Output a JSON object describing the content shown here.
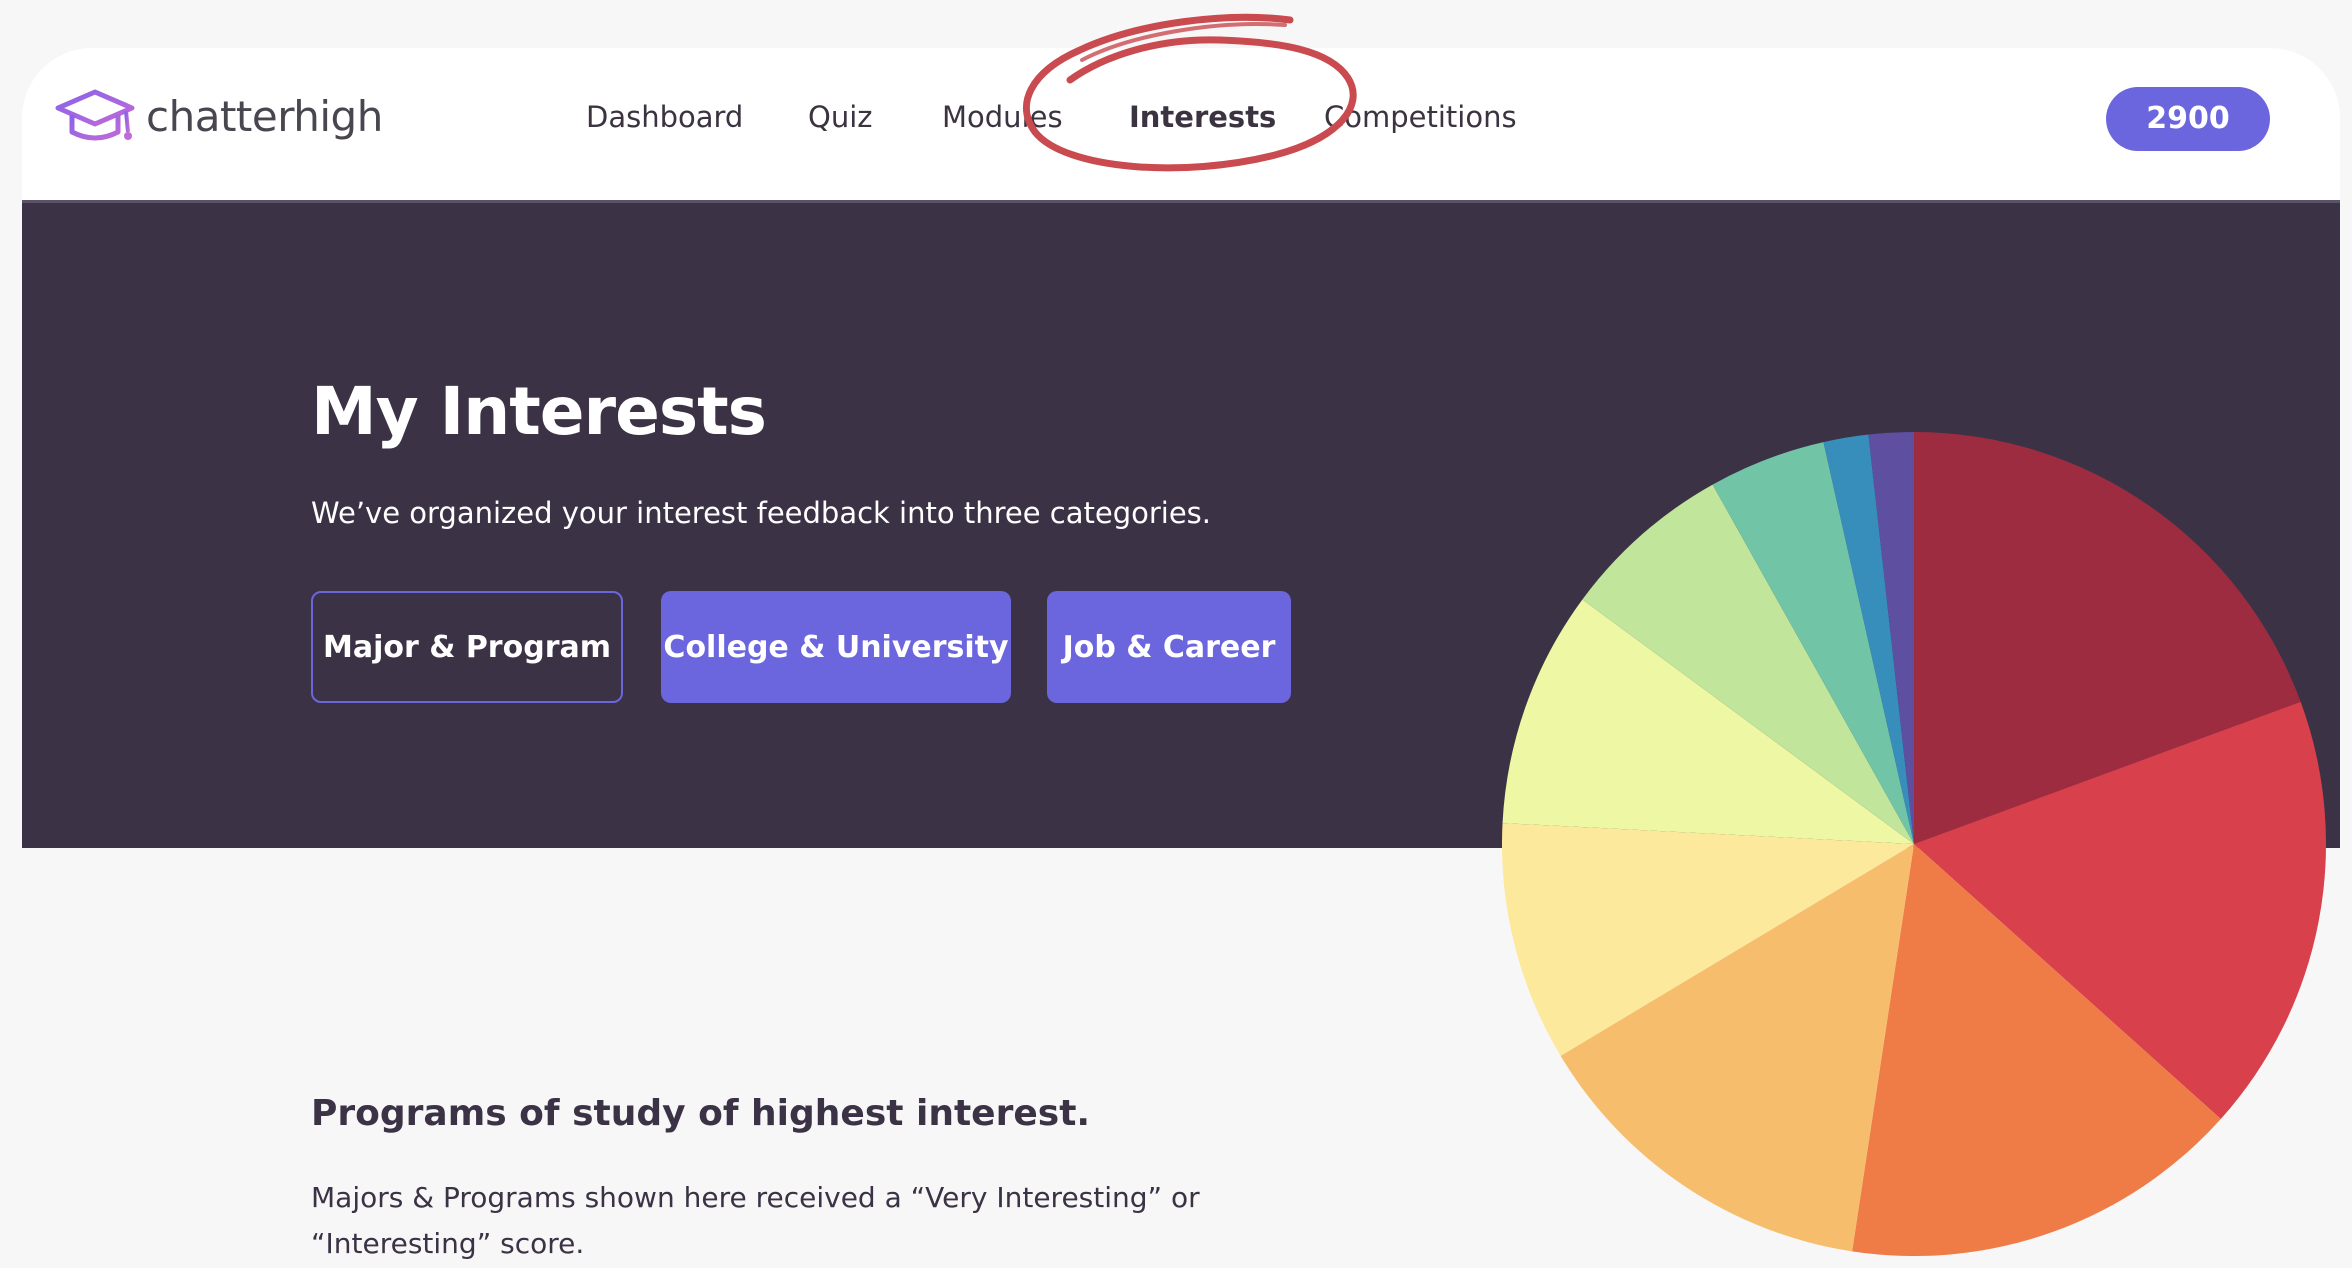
{
  "app": {
    "logo_text": "chatterhigh"
  },
  "nav": {
    "items": [
      {
        "label": "Dashboard"
      },
      {
        "label": "Quiz"
      },
      {
        "label": "Modules"
      },
      {
        "label": "Interests",
        "active": true
      },
      {
        "label": "Competitions"
      }
    ]
  },
  "points": {
    "value": "2900"
  },
  "hero": {
    "title": "My Interests",
    "subtitle": "We’ve organized your interest feedback into three categories.",
    "buttons": [
      {
        "label": "Major & Program",
        "style": "outline"
      },
      {
        "label": "College & University",
        "style": "filled"
      },
      {
        "label": "Job & Career",
        "style": "filled"
      }
    ]
  },
  "section": {
    "title": "Programs of study of highest interest.",
    "description": "Majors & Programs shown here received a “Very Interesting” or “Interesting” score."
  },
  "colors": {
    "accent": "#6b66dd",
    "hero_bg": "#3c3246",
    "annotation": "#c94a4f"
  },
  "chart_data": {
    "type": "pie",
    "title": "",
    "slices": [
      {
        "value": 19.8,
        "color": "#9e2c41"
      },
      {
        "value": 17.6,
        "color": "#d8414c"
      },
      {
        "value": 16.1,
        "color": "#ef7b47"
      },
      {
        "value": 14.3,
        "color": "#f6bd6c"
      },
      {
        "value": 9.6,
        "color": "#fde99c"
      },
      {
        "value": 9.5,
        "color": "#eef7a3"
      },
      {
        "value": 6.9,
        "color": "#c0e59b"
      },
      {
        "value": 4.7,
        "color": "#71c4a5"
      },
      {
        "value": 1.8,
        "color": "#378ebb"
      },
      {
        "value": 1.8,
        "color": "#5e4fa1"
      }
    ]
  }
}
